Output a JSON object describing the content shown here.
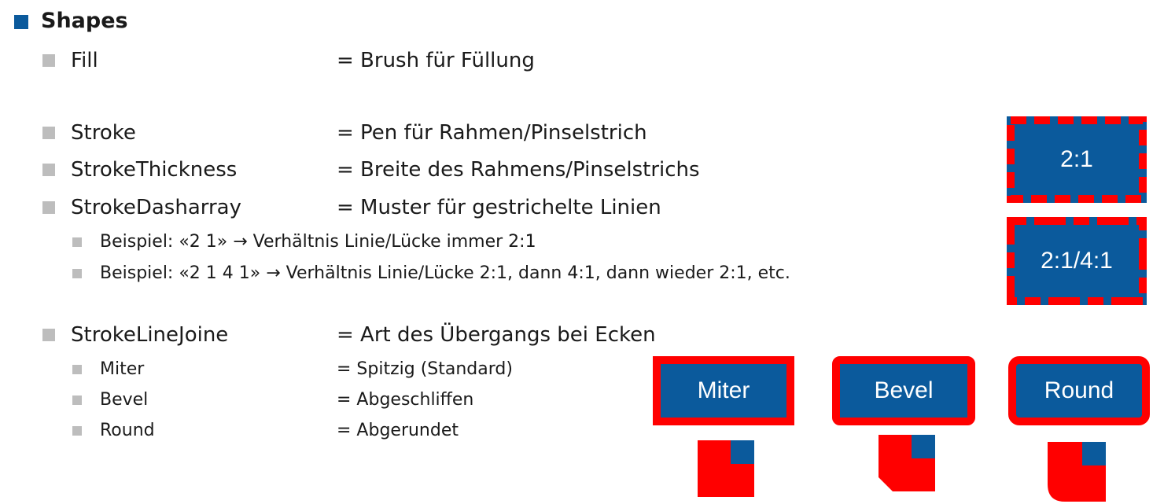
{
  "heading": "Shapes",
  "colors": {
    "accent": "#0b5a9c",
    "stroke": "#ff0000",
    "bullet_secondary": "#bdbdbd"
  },
  "properties": [
    {
      "name": "Fill",
      "desc": "= Brush für Füllung"
    },
    {
      "name": "Stroke",
      "desc": "= Pen für Rahmen/Pinselstrich"
    },
    {
      "name": "StrokeThickness",
      "desc": "= Breite des Rahmens/Pinselstrichs"
    },
    {
      "name": "StrokeDasharray",
      "desc": "= Muster für gestrichelte Linien"
    },
    {
      "name": "StrokeLineJoine",
      "desc": "= Art des Übergangs bei Ecken"
    }
  ],
  "dash_examples": [
    "Beispiel: «2 1» → Verhältnis Linie/Lücke immer 2:1",
    "Beispiel: «2 1 4 1» → Verhältnis Linie/Lücke 2:1, dann 4:1, dann wieder 2:1, etc."
  ],
  "join_items": [
    {
      "name": "Miter",
      "desc": "= Spitzig (Standard)"
    },
    {
      "name": "Bevel",
      "desc": "= Abgeschliffen"
    },
    {
      "name": "Round",
      "desc": "= Abgerundet"
    }
  ],
  "dash_boxes": [
    "2:1",
    "2:1/4:1"
  ],
  "join_boxes": [
    "Miter",
    "Bevel",
    "Round"
  ]
}
